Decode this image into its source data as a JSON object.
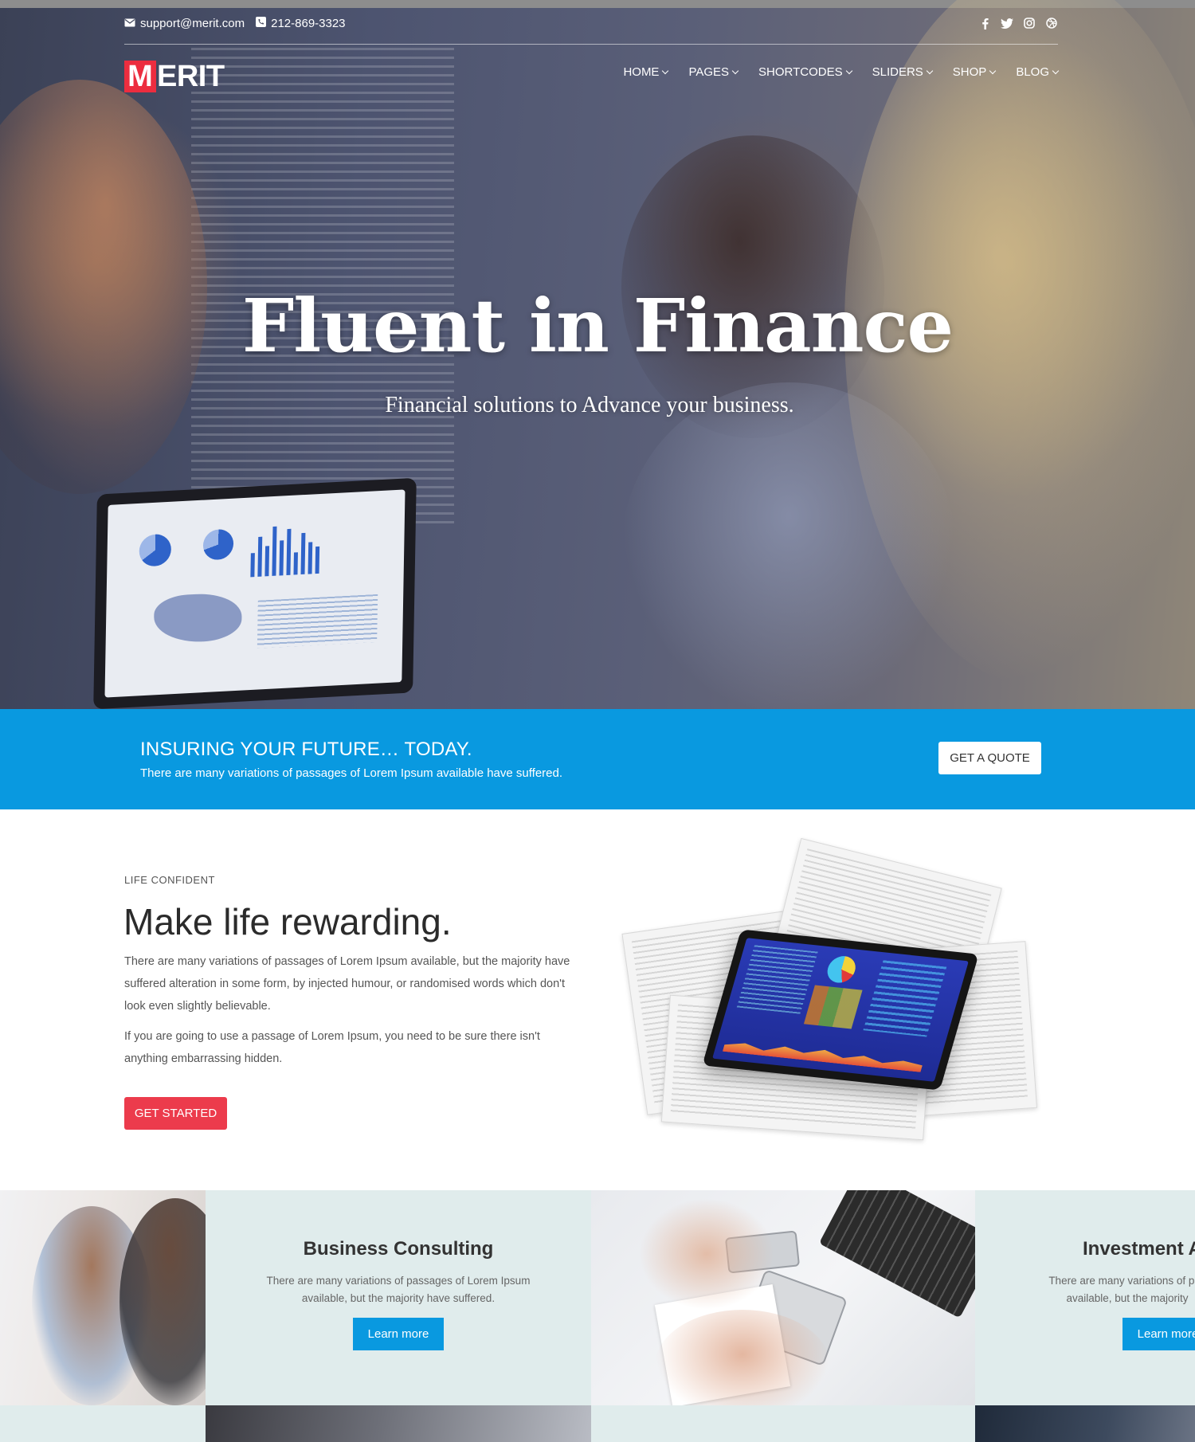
{
  "topbar": {
    "email": "support@merit.com",
    "phone": "212-869-3323",
    "social": [
      "facebook-icon",
      "twitter-icon",
      "instagram-icon",
      "dribbble-icon"
    ]
  },
  "brand": {
    "logo_initial": "M",
    "logo_rest": "ERIT",
    "accent_color": "#ec2d3f"
  },
  "nav": {
    "items": [
      {
        "label": "HOME"
      },
      {
        "label": "PAGES"
      },
      {
        "label": "SHORTCODES"
      },
      {
        "label": "SLIDERS"
      },
      {
        "label": "SHOP"
      },
      {
        "label": "BLOG"
      }
    ]
  },
  "hero": {
    "title": "Fluent in Finance",
    "subtitle": "Financial solutions to Advance your business."
  },
  "cta": {
    "title": "INSURING YOUR FUTURE… TODAY.",
    "text": "There are many variations of passages of Lorem Ipsum available have suffered.",
    "button": "GET A QUOTE",
    "background_color": "#0999e0"
  },
  "about": {
    "eyebrow": "LIFE CONFIDENT",
    "title": "Make life rewarding.",
    "paragraph1": "There are many variations of passages of Lorem Ipsum available, but the majority have suffered alteration in some form, by injected humour, or randomised words which don't look even slightly believable.",
    "paragraph2": "If you are going to use a passage of Lorem Ipsum, you need to be sure there isn't anything embarrassing hidden.",
    "button": "GET STARTED",
    "button_color": "#ec3b4c"
  },
  "services": [
    {
      "title": "Business Consulting",
      "text": "There are many variations of passages of Lorem Ipsum available, but the majority have suffered.",
      "button": "Learn more"
    },
    {
      "title": "Investment A",
      "text": "There are many variations of pas available, but the majority",
      "button": "Learn more"
    }
  ]
}
